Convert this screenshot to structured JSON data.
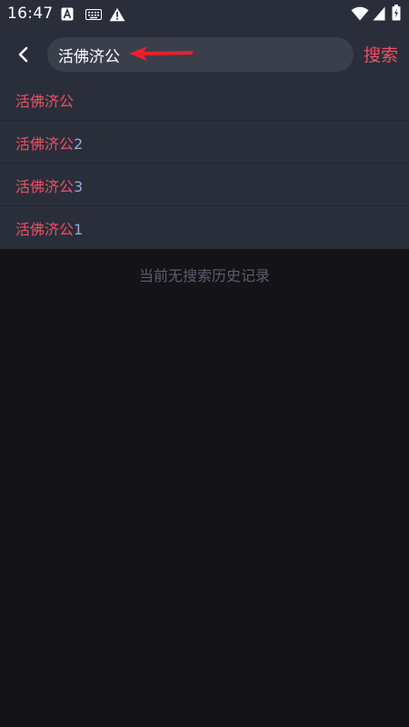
{
  "status_bar": {
    "time": "16:47"
  },
  "header": {
    "back_icon": "chevron-left-icon",
    "search_value": "活佛济公",
    "search_button_label": "搜索"
  },
  "suggestions": [
    {
      "match": "活佛济公",
      "rest": ""
    },
    {
      "match": "活佛济公",
      "rest": "2"
    },
    {
      "match": "活佛济公",
      "rest": "3"
    },
    {
      "match": "活佛济公",
      "rest": "1"
    }
  ],
  "empty_history_text": "当前无搜索历史记录",
  "colors": {
    "accent": "#ef4f63",
    "suggestion_rest": "#9ea7d6",
    "header_bg": "#2a2e3b",
    "search_box_bg": "#3b3f4c",
    "page_bg": "#131318",
    "muted_text": "#5a5e6a",
    "annotation_arrow": "#e8212d"
  }
}
